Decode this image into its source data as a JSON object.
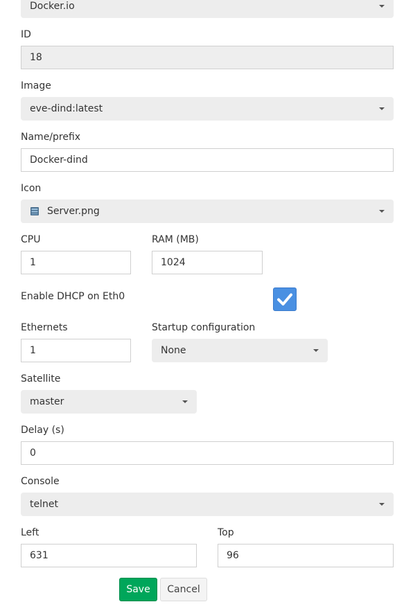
{
  "form": {
    "template_select": {
      "value": "Docker.io"
    },
    "id": {
      "label": "ID",
      "value": "18"
    },
    "image": {
      "label": "Image",
      "value": "eve-dind:latest"
    },
    "name": {
      "label": "Name/prefix",
      "value": "Docker-dind"
    },
    "icon": {
      "label": "Icon",
      "value": "Server.png",
      "icon_name": "server-icon"
    },
    "cpu": {
      "label": "CPU",
      "value": "1"
    },
    "ram": {
      "label": "RAM (MB)",
      "value": "1024"
    },
    "dhcp": {
      "label": "Enable DHCP on Eth0",
      "checked": true
    },
    "ethernets": {
      "label": "Ethernets",
      "value": "1"
    },
    "startup": {
      "label": "Startup configuration",
      "value": "None"
    },
    "satellite": {
      "label": "Satellite",
      "value": "master"
    },
    "delay": {
      "label": "Delay (s)",
      "value": "0"
    },
    "console": {
      "label": "Console",
      "value": "telnet"
    },
    "left": {
      "label": "Left",
      "value": "631"
    },
    "top": {
      "label": "Top",
      "value": "96"
    }
  },
  "buttons": {
    "save": "Save",
    "cancel": "Cancel"
  },
  "colors": {
    "accent": "#4a90e2",
    "save": "#00a65a"
  }
}
